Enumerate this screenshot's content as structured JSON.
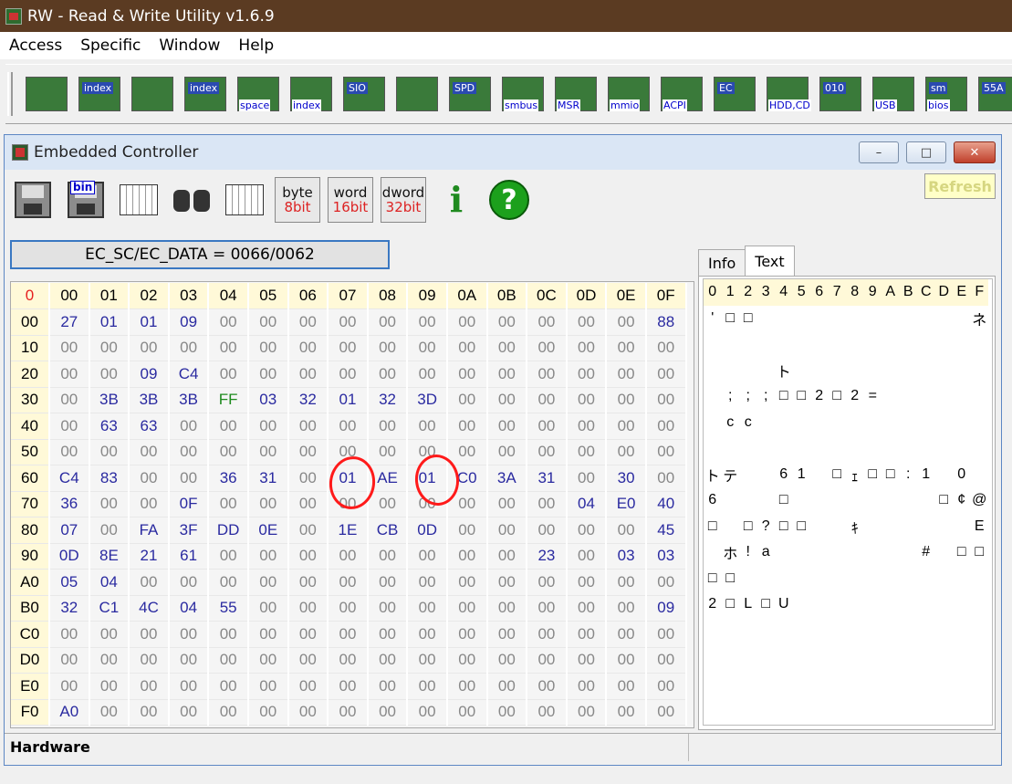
{
  "app": {
    "title": "RW - Read & Write Utility v1.6.9"
  },
  "menu": [
    "Access",
    "Specific",
    "Window",
    "Help"
  ],
  "main_toolbar": [
    {
      "name": "pci-icon",
      "tag": "",
      "tag2": ""
    },
    {
      "name": "pci-index-icon",
      "tag": "index",
      "tag2": ""
    },
    {
      "name": "memory-icon",
      "tag": "",
      "tag2": ""
    },
    {
      "name": "memory-index-icon",
      "tag": "index",
      "tag2": ""
    },
    {
      "name": "io-space-icon",
      "tag": "",
      "tag2": "space"
    },
    {
      "name": "io-index-icon",
      "tag": "",
      "tag2": "index"
    },
    {
      "name": "sio-icon",
      "tag": "SIO",
      "tag2": ""
    },
    {
      "name": "oscilloscope-icon",
      "tag": "",
      "tag2": ""
    },
    {
      "name": "spd-icon",
      "tag": "SPD",
      "tag2": ""
    },
    {
      "name": "smbus-icon",
      "tag": "",
      "tag2": "smbus"
    },
    {
      "name": "msr-icon",
      "tag": "",
      "tag2": "MSR"
    },
    {
      "name": "mmio-icon",
      "tag": "",
      "tag2": "mmio"
    },
    {
      "name": "acpi-icon",
      "tag": "",
      "tag2": "ACPI"
    },
    {
      "name": "ec-icon",
      "tag": "EC",
      "tag2": ""
    },
    {
      "name": "hdd-cd-icon",
      "tag": "",
      "tag2": "HDD,CD"
    },
    {
      "name": "disk-010-icon",
      "tag": "010",
      "tag2": ""
    },
    {
      "name": "usb-icon",
      "tag": "",
      "tag2": "USB"
    },
    {
      "name": "smbios-icon",
      "tag": "sm",
      "tag2": "bios"
    },
    {
      "name": "55aa-icon",
      "tag": "55A",
      "tag2": ""
    }
  ],
  "ec_window": {
    "title": "Embedded Controller",
    "min_label": "–",
    "max_label": "□",
    "close_label": "✕",
    "refresh_label": "Refresh",
    "toolbar": {
      "bin_label": "bin",
      "byte_top": "byte",
      "byte_bot": "8bit",
      "word_top": "word",
      "word_bot": "16bit",
      "dword_top": "dword",
      "dword_bot": "32bit",
      "info_label": "i",
      "help_label": "?"
    },
    "address": "EC_SC/EC_DATA = 0066/0062",
    "tabs": [
      "Info",
      "Text"
    ],
    "status": "Hardware",
    "corner": "0",
    "col_headers": [
      "00",
      "01",
      "02",
      "03",
      "04",
      "05",
      "06",
      "07",
      "08",
      "09",
      "0A",
      "0B",
      "0C",
      "0D",
      "0E",
      "0F"
    ],
    "rows": [
      {
        "addr": "00",
        "cells": [
          "27",
          "01",
          "01",
          "09",
          "00",
          "00",
          "00",
          "00",
          "00",
          "00",
          "00",
          "00",
          "00",
          "00",
          "00",
          "88"
        ]
      },
      {
        "addr": "10",
        "cells": [
          "00",
          "00",
          "00",
          "00",
          "00",
          "00",
          "00",
          "00",
          "00",
          "00",
          "00",
          "00",
          "00",
          "00",
          "00",
          "00"
        ]
      },
      {
        "addr": "20",
        "cells": [
          "00",
          "00",
          "09",
          "C4",
          "00",
          "00",
          "00",
          "00",
          "00",
          "00",
          "00",
          "00",
          "00",
          "00",
          "00",
          "00"
        ]
      },
      {
        "addr": "30",
        "cells": [
          "00",
          "3B",
          "3B",
          "3B",
          "FF",
          "03",
          "32",
          "01",
          "32",
          "3D",
          "00",
          "00",
          "00",
          "00",
          "00",
          "00"
        ]
      },
      {
        "addr": "40",
        "cells": [
          "00",
          "63",
          "63",
          "00",
          "00",
          "00",
          "00",
          "00",
          "00",
          "00",
          "00",
          "00",
          "00",
          "00",
          "00",
          "00"
        ]
      },
      {
        "addr": "50",
        "cells": [
          "00",
          "00",
          "00",
          "00",
          "00",
          "00",
          "00",
          "00",
          "00",
          "00",
          "00",
          "00",
          "00",
          "00",
          "00",
          "00"
        ]
      },
      {
        "addr": "60",
        "cells": [
          "C4",
          "83",
          "00",
          "00",
          "36",
          "31",
          "00",
          "01",
          "AE",
          "01",
          "C0",
          "3A",
          "31",
          "00",
          "30",
          "00"
        ]
      },
      {
        "addr": "70",
        "cells": [
          "36",
          "00",
          "00",
          "0F",
          "00",
          "00",
          "00",
          "00",
          "00",
          "00",
          "00",
          "00",
          "00",
          "04",
          "E0",
          "40"
        ]
      },
      {
        "addr": "80",
        "cells": [
          "07",
          "00",
          "FA",
          "3F",
          "DD",
          "0E",
          "00",
          "1E",
          "CB",
          "0D",
          "00",
          "00",
          "00",
          "00",
          "00",
          "45"
        ]
      },
      {
        "addr": "90",
        "cells": [
          "0D",
          "8E",
          "21",
          "61",
          "00",
          "00",
          "00",
          "00",
          "00",
          "00",
          "00",
          "00",
          "23",
          "00",
          "03",
          "03"
        ]
      },
      {
        "addr": "A0",
        "cells": [
          "05",
          "04",
          "00",
          "00",
          "00",
          "00",
          "00",
          "00",
          "00",
          "00",
          "00",
          "00",
          "00",
          "00",
          "00",
          "00"
        ]
      },
      {
        "addr": "B0",
        "cells": [
          "32",
          "C1",
          "4C",
          "04",
          "55",
          "00",
          "00",
          "00",
          "00",
          "00",
          "00",
          "00",
          "00",
          "00",
          "00",
          "09"
        ]
      },
      {
        "addr": "C0",
        "cells": [
          "00",
          "00",
          "00",
          "00",
          "00",
          "00",
          "00",
          "00",
          "00",
          "00",
          "00",
          "00",
          "00",
          "00",
          "00",
          "00"
        ]
      },
      {
        "addr": "D0",
        "cells": [
          "00",
          "00",
          "00",
          "00",
          "00",
          "00",
          "00",
          "00",
          "00",
          "00",
          "00",
          "00",
          "00",
          "00",
          "00",
          "00"
        ]
      },
      {
        "addr": "E0",
        "cells": [
          "00",
          "00",
          "00",
          "00",
          "00",
          "00",
          "00",
          "00",
          "00",
          "00",
          "00",
          "00",
          "00",
          "00",
          "00",
          "00"
        ]
      },
      {
        "addr": "F0",
        "cells": [
          "A0",
          "00",
          "00",
          "00",
          "00",
          "00",
          "00",
          "00",
          "00",
          "00",
          "00",
          "00",
          "00",
          "00",
          "00",
          "00"
        ]
      }
    ],
    "text_header": [
      "0",
      "1",
      "2",
      "3",
      "4",
      "5",
      "6",
      "7",
      "8",
      "9",
      "A",
      "B",
      "C",
      "D",
      "E",
      "F"
    ],
    "text_rows": [
      [
        "'",
        "□",
        "□",
        "",
        "",
        "",
        "",
        "",
        "",
        "",
        "",
        "",
        "",
        "",
        "",
        "ネ"
      ],
      [
        "",
        "",
        "",
        "",
        "",
        "",
        "",
        "",
        "",
        "",
        "",
        "",
        "",
        "",
        "",
        ""
      ],
      [
        "",
        "",
        "",
        "",
        "ト",
        "",
        "",
        "",
        "",
        "",
        "",
        "",
        "",
        "",
        "",
        ""
      ],
      [
        "",
        ";",
        ";",
        ";",
        "□",
        "□",
        "2",
        "□",
        "2",
        "=",
        "",
        "",
        "",
        "",
        "",
        ""
      ],
      [
        "",
        "c",
        "c",
        "",
        "",
        "",
        "",
        "",
        "",
        "",
        "",
        "",
        "",
        "",
        "",
        ""
      ],
      [
        "",
        "",
        "",
        "",
        "",
        "",
        "",
        "",
        "",
        "",
        "",
        "",
        "",
        "",
        "",
        ""
      ],
      [
        "ト",
        "テ",
        "",
        "",
        "6",
        "1",
        "",
        "□",
        "ｪ",
        "□",
        "□",
        ":",
        "1",
        "",
        "0",
        ""
      ],
      [
        "6",
        "",
        "",
        "",
        "□",
        "",
        "",
        "",
        "",
        "",
        "",
        "",
        "",
        "□",
        "¢",
        "@"
      ],
      [
        "□",
        "",
        "□",
        "?",
        "□",
        "□",
        "",
        "",
        "ｷ",
        "",
        "",
        "",
        "",
        "",
        "",
        "E"
      ],
      [
        "",
        "ホ",
        "!",
        "a",
        "",
        "",
        "",
        "",
        "",
        "",
        "",
        "",
        "#",
        "",
        "□",
        "□"
      ],
      [
        "□",
        "□",
        "",
        "",
        "",
        "",
        "",
        "",
        "",
        "",
        "",
        "",
        "",
        "",
        "",
        ""
      ],
      [
        "2",
        "□",
        "L",
        "□",
        "U",
        "",
        "",
        "",
        "",
        "",
        "",
        "",
        "",
        "",
        "",
        ""
      ],
      [
        "",
        "",
        "",
        "",
        "",
        "",
        "",
        "",
        "",
        "",
        "",
        "",
        "",
        "",
        "",
        ""
      ],
      [
        "",
        "",
        "",
        "",
        "",
        "",
        "",
        "",
        "",
        "",
        "",
        "",
        "",
        "",
        "",
        ""
      ],
      [
        "",
        "",
        "",
        "",
        "",
        "",
        "",
        "",
        "",
        "",
        "",
        "",
        "",
        "",
        "",
        ""
      ],
      [
        "",
        "",
        "",
        "",
        "",
        "",
        "",
        "",
        "",
        "",
        "",
        "",
        "",
        "",
        "",
        ""
      ]
    ],
    "annotations": [
      "circle-0x67",
      "circle-0x69"
    ]
  }
}
